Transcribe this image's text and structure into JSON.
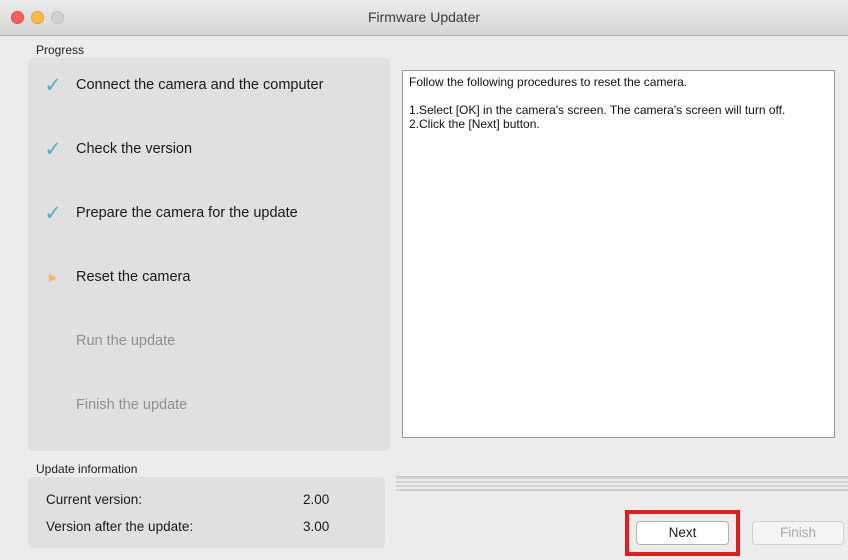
{
  "window": {
    "title": "Firmware Updater",
    "controls": [
      "close",
      "minimize",
      "zoom"
    ]
  },
  "progress": {
    "label": "Progress",
    "steps": [
      {
        "label": "Connect the camera and the computer",
        "status": "done",
        "icon": "checkmark-icon"
      },
      {
        "label": "Check the version",
        "status": "done",
        "icon": "checkmark-icon"
      },
      {
        "label": "Prepare the camera for the update",
        "status": "done",
        "icon": "checkmark-icon"
      },
      {
        "label": "Reset the camera",
        "status": "current",
        "icon": "current-step-arrow-icon"
      },
      {
        "label": "Run the update",
        "status": "pending"
      },
      {
        "label": "Finish the update",
        "status": "pending"
      }
    ]
  },
  "instructions": {
    "intro": "Follow the following procedures to reset the camera.",
    "lines": [
      "1.Select [OK] in the camera's screen. The camera's screen will turn off.",
      "2.Click the [Next] button."
    ]
  },
  "update_info": {
    "label": "Update information",
    "current_version_label": "Current version:",
    "current_version": "2.00",
    "new_version_label": "Version after the update:",
    "new_version": "3.00"
  },
  "buttons": {
    "next": "Next",
    "finish": "Finish",
    "finish_enabled": false
  },
  "colors": {
    "check": "#4fb0d0",
    "current_arrow": "#f3b76a",
    "highlight": "#e51c1c"
  }
}
